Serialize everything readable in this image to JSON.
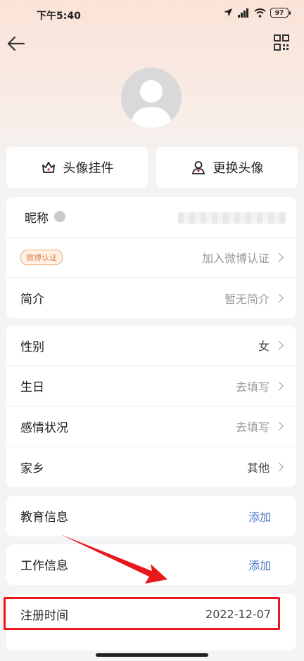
{
  "status": {
    "time": "下午5:40",
    "battery": "97"
  },
  "actions": {
    "pendant_label": "头像挂件",
    "change_avatar_label": "更换头像"
  },
  "profile_card": {
    "nickname_label": "昵称",
    "verify_badge": "微博认证",
    "verify_action": "加入微博认证",
    "intro_label": "简介",
    "intro_value": "暂无简介"
  },
  "personal_card": {
    "gender_label": "性别",
    "gender_value": "女",
    "birthday_label": "生日",
    "birthday_value": "去填写",
    "relationship_label": "感情状况",
    "relationship_value": "去填写",
    "hometown_label": "家乡",
    "hometown_value": "其他"
  },
  "education": {
    "label": "教育信息",
    "action": "添加"
  },
  "work": {
    "label": "工作信息",
    "action": "添加"
  },
  "registration": {
    "label": "注册时间",
    "value": "2022-12-07"
  },
  "icons": [
    "back-arrow-icon",
    "qr-code-icon",
    "pendant-icon",
    "user-icon",
    "crown-icon",
    "chevron-right-icon"
  ],
  "colors": {
    "accent_blue": "#4a77c2",
    "annotation_red": "#e8191c",
    "badge_orange": "#e0864a"
  }
}
